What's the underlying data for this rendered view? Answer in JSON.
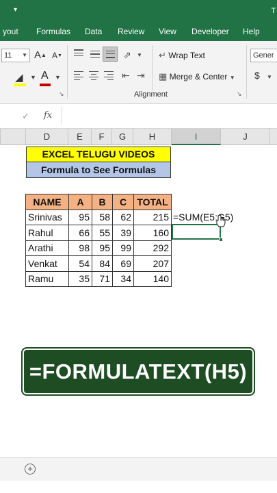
{
  "titlebar": {
    "quick_access_icon": "dropdown-icon",
    "title_fragment": "T"
  },
  "tabs": [
    "yout",
    "Formulas",
    "Data",
    "Review",
    "View",
    "Developer",
    "Help"
  ],
  "ribbon": {
    "font_size": "11",
    "grow_font": "A",
    "shrink_font": "A",
    "font_color_letter": "A",
    "wrap_text": "Wrap Text",
    "merge_center": "Merge & Center",
    "number_format": "Gener",
    "currency": "$",
    "alignment_group": "Alignment",
    "colors": {
      "font_color": "#c00000",
      "fill_color": "#ffff00"
    }
  },
  "formula_bar": {
    "cancel": "✓",
    "fx": "fx",
    "value": ""
  },
  "columns": [
    "D",
    "E",
    "F",
    "G",
    "H",
    "I",
    "J"
  ],
  "selected_column": "I",
  "sheet": {
    "banner_title": "EXCEL TELUGU VIDEOS",
    "banner_subtitle": "Formula to See Formulas",
    "headers": [
      "NAME",
      "A",
      "B",
      "C",
      "TOTAL"
    ],
    "rows": [
      [
        "Srinivas",
        "95",
        "58",
        "62",
        "215"
      ],
      [
        "Rahul",
        "66",
        "55",
        "39",
        "160"
      ],
      [
        "Arathi",
        "98",
        "95",
        "99",
        "292"
      ],
      [
        "Venkat",
        "54",
        "84",
        "69",
        "207"
      ],
      [
        "Ramu",
        "35",
        "71",
        "34",
        "140"
      ]
    ],
    "formula_display": "=SUM(E5:G5)",
    "callout": "=FORMULATEXT(H5)"
  },
  "sheetbar": {
    "add_sheet": "+"
  }
}
